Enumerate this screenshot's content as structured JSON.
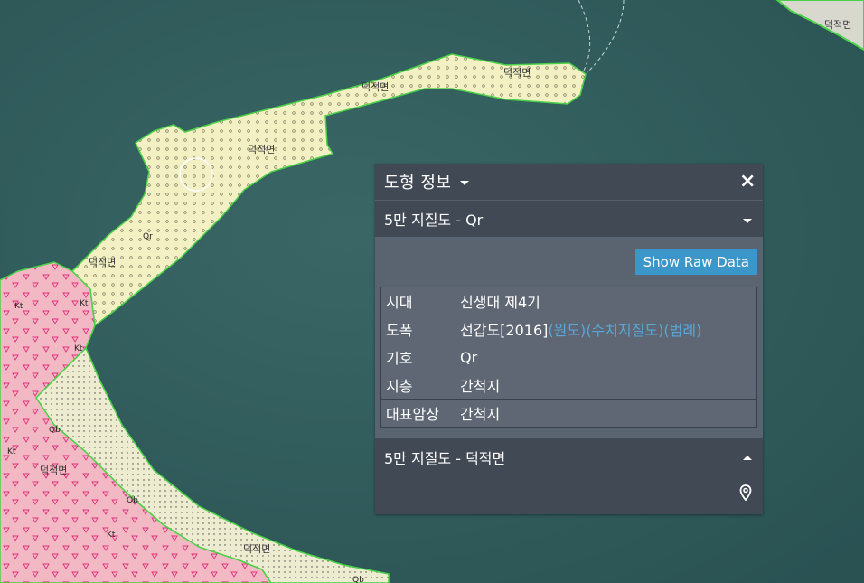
{
  "map": {
    "labels": {
      "geo_name": "덕적면",
      "qr": "Qr",
      "kt": "Kt",
      "qb": "Qb"
    },
    "colors": {
      "sea": "#2f5b5c",
      "qr_fill": "#f3f0c4",
      "kt_fill": "#f2b9c4",
      "qb_fill": "#eeecd0",
      "boundary": "#4bd147"
    }
  },
  "panel": {
    "title": "도형 정보",
    "close_icon": "×",
    "layer1": "5만 지질도 - Qr",
    "raw_button": "Show Raw Data",
    "rows": [
      {
        "key": "시대",
        "value": "신생대 제4기"
      },
      {
        "key": "도폭",
        "value": "선갑도[2016]",
        "links": [
          "(원도)",
          "(수치지질도)",
          "(범례)"
        ]
      },
      {
        "key": "기호",
        "value": "Qr"
      },
      {
        "key": "지층",
        "value": "간척지"
      },
      {
        "key": "대표암상",
        "value": "간척지"
      }
    ],
    "layer2": "5만 지질도 - 덕적면",
    "pin_icon": "map-pin-icon"
  }
}
